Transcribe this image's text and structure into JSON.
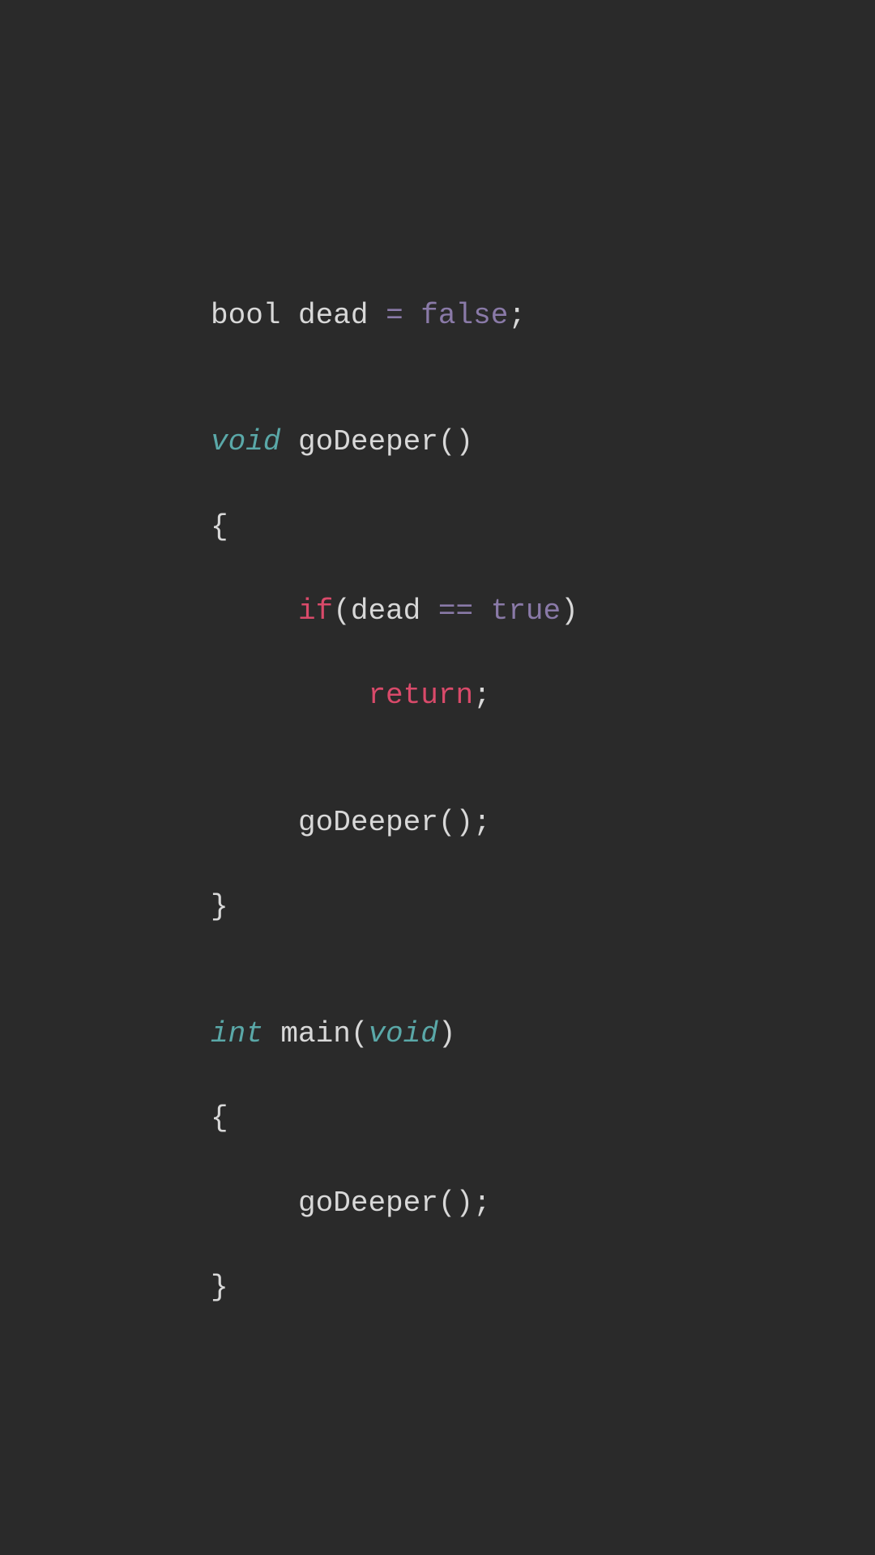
{
  "code": {
    "line1": {
      "type": "bool",
      "space1": " ",
      "var": "dead",
      "space2": " ",
      "op": "=",
      "space3": " ",
      "val": "false",
      "semi": ";"
    },
    "line2": "",
    "line3": {
      "type": "void",
      "space1": " ",
      "func": "goDeeper",
      "paren": "()"
    },
    "line4": {
      "brace": "{"
    },
    "line5": {
      "indent": "     ",
      "kw": "if",
      "paren_open": "(",
      "var": "dead",
      "space1": " ",
      "op": "==",
      "space2": " ",
      "val": "true",
      "paren_close": ")"
    },
    "line6": {
      "indent": "         ",
      "kw": "return",
      "semi": ";"
    },
    "line7": "",
    "line8": {
      "indent": "     ",
      "func": "goDeeper",
      "paren": "()",
      "semi": ";"
    },
    "line9": {
      "brace": "}"
    },
    "line10": "",
    "line11": {
      "type": "int",
      "space1": " ",
      "func": "main",
      "paren_open": "(",
      "param_type": "void",
      "paren_close": ")"
    },
    "line12": {
      "brace": "{"
    },
    "line13": {
      "indent": "     ",
      "func": "goDeeper",
      "paren": "()",
      "semi": ";"
    },
    "line14": {
      "brace": "}"
    }
  }
}
